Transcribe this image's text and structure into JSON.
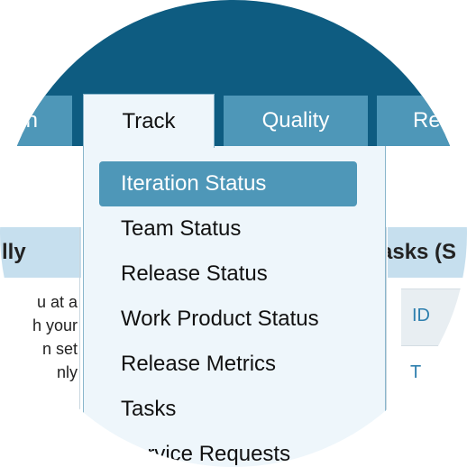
{
  "nav": {
    "tabs": [
      {
        "label": "n"
      },
      {
        "label": "Track"
      },
      {
        "label": "Quality"
      },
      {
        "label": "Re"
      }
    ]
  },
  "menu": {
    "items": [
      {
        "label": "Iteration Status",
        "active": true
      },
      {
        "label": "Team Status"
      },
      {
        "label": "Release Status"
      },
      {
        "label": "Work Product Status"
      },
      {
        "label": "Release Metrics"
      },
      {
        "label": "Tasks"
      },
      {
        "label": "Service Requests"
      }
    ]
  },
  "left_panel": {
    "title": "lly",
    "text": [
      "u at a",
      "h your",
      "n set",
      "nly"
    ]
  },
  "right_panel": {
    "title": "asks (S",
    "column_id": "ID",
    "cell": "T"
  },
  "colors": {
    "header_bg": "#0e5c81",
    "tab_bg": "#4e97b8",
    "menu_bg": "#eef6fb",
    "panel_header_bg": "#c6dfee",
    "link": "#2e7fae"
  }
}
